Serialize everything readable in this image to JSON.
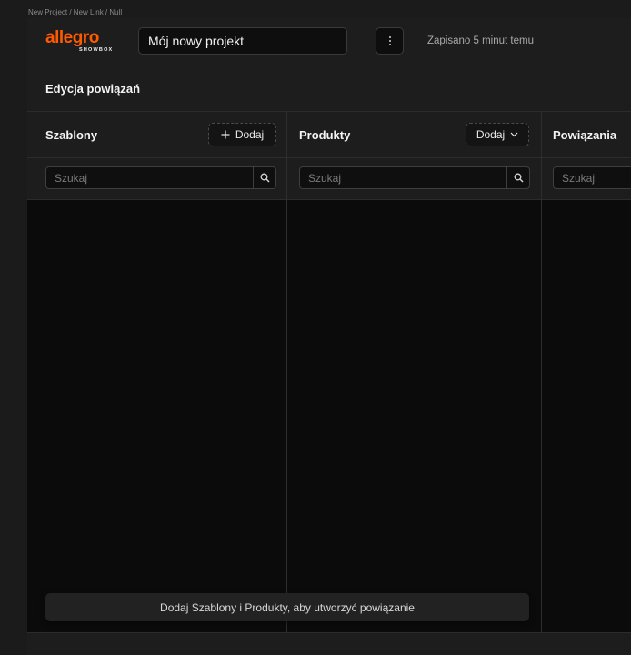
{
  "breadcrumb": "New Project / New Link / Null",
  "header": {
    "logo_word": "allegro",
    "logo_sub": "SHOWBOX",
    "project_name": "Mój nowy projekt",
    "more_icon": "vertical-dots-icon",
    "saved_status": "Zapisano 5 minut temu"
  },
  "section": {
    "title": "Edycja powiązań"
  },
  "columns": {
    "templates": {
      "title": "Szablony",
      "add_label": "Dodaj",
      "search_placeholder": "Szukaj"
    },
    "products": {
      "title": "Produkty",
      "add_label": "Dodaj",
      "search_placeholder": "Szukaj"
    },
    "links": {
      "title": "Powiązania",
      "search_placeholder": "Szukaj"
    }
  },
  "toast": {
    "message": "Dodaj Szablony i Produkty, aby utworzyć powiązanie"
  },
  "colors": {
    "brand": "#ff5a00",
    "background": "#1d1d1d",
    "panel": "#0b0b0b"
  }
}
